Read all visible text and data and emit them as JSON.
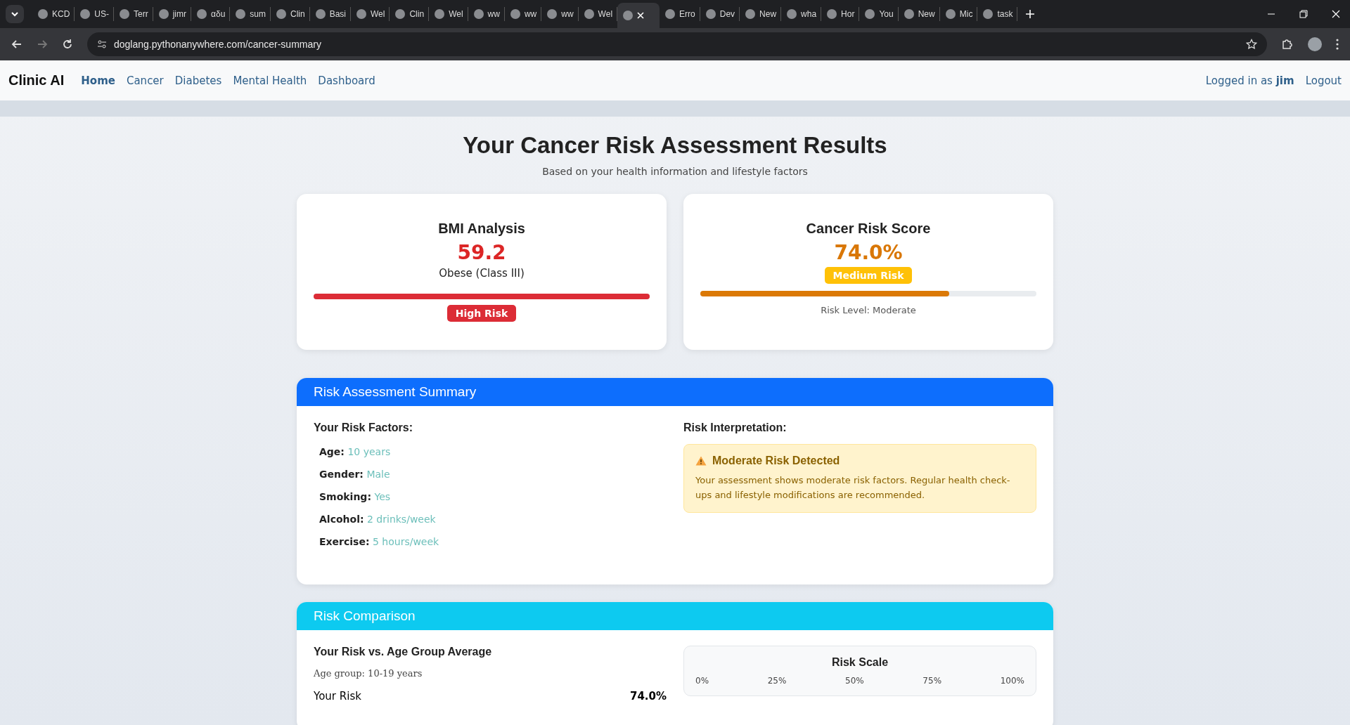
{
  "browser": {
    "tabs": [
      {
        "label": "KCD",
        "selected": false
      },
      {
        "label": "US-",
        "selected": false
      },
      {
        "label": "Terr",
        "selected": false
      },
      {
        "label": "jimr",
        "selected": false
      },
      {
        "label": "αδu",
        "selected": false
      },
      {
        "label": "sum",
        "selected": false
      },
      {
        "label": "Clin",
        "selected": false
      },
      {
        "label": "Basi",
        "selected": false
      },
      {
        "label": "Wel",
        "selected": false
      },
      {
        "label": "Clin",
        "selected": false
      },
      {
        "label": "Wel",
        "selected": false
      },
      {
        "label": "ww",
        "selected": false
      },
      {
        "label": "ww",
        "selected": false
      },
      {
        "label": "ww",
        "selected": false
      },
      {
        "label": "Wel",
        "selected": false
      },
      {
        "selected": true
      },
      {
        "label": "Erro",
        "selected": false
      },
      {
        "label": "Dev",
        "selected": false
      },
      {
        "label": "New",
        "selected": false
      },
      {
        "label": "wha",
        "selected": false
      },
      {
        "label": "Hor",
        "selected": false
      },
      {
        "label": "You",
        "selected": false
      },
      {
        "label": "New",
        "selected": false
      },
      {
        "label": "Mic",
        "selected": false
      },
      {
        "label": "task",
        "selected": false
      }
    ],
    "url": "doglang.pythonanywhere.com/cancer-summary"
  },
  "navbar": {
    "brand": "Clinic AI",
    "links": [
      {
        "label": "Home",
        "selected": true
      },
      {
        "label": "Cancer",
        "selected": false
      },
      {
        "label": "Diabetes",
        "selected": false
      },
      {
        "label": "Mental Health",
        "selected": false
      },
      {
        "label": "Dashboard",
        "selected": false
      }
    ],
    "logged_in_prefix": "Logged in as",
    "user": "jim",
    "logout": "Logout"
  },
  "page": {
    "title": "Your Cancer Risk Assessment Results",
    "subtitle": "Based on your health information and lifestyle factors"
  },
  "bmi_card": {
    "title": "BMI Analysis",
    "value": "59.2",
    "category": "Obese (Class III)",
    "level": 1,
    "badge": "High Risk"
  },
  "risk_card": {
    "title": "Cancer Risk Score",
    "value": "74.0%",
    "badge": "Medium Risk",
    "level": 0.74,
    "caption": "Risk Level: Moderate"
  },
  "summary": {
    "header": "Risk Assessment Summary",
    "factors_title": "Your Risk Factors:",
    "factors": [
      {
        "label": "Age:",
        "value": "10 years"
      },
      {
        "label": "Gender:",
        "value": "Male"
      },
      {
        "label": "Smoking:",
        "value": "Yes"
      },
      {
        "label": "Alcohol:",
        "value": "2 drinks/week"
      },
      {
        "label": "Exercise:",
        "value": "5 hours/week"
      }
    ],
    "interpretation_title": "Risk Interpretation:",
    "alert_title": "Moderate Risk Detected",
    "alert_text": "Your assessment shows moderate risk factors. Regular health check-ups and lifestyle modifications are recommended."
  },
  "comparison": {
    "header": "Risk Comparison",
    "subtitle": "Your Risk vs. Age Group Average",
    "age_group": "Age group: 10-19 years",
    "your_risk_label": "Your Risk",
    "your_risk_value": "74.0%",
    "scale_title": "Risk Scale",
    "scale_labels": [
      "0%",
      "25%",
      "50%",
      "75%",
      "100%"
    ]
  }
}
